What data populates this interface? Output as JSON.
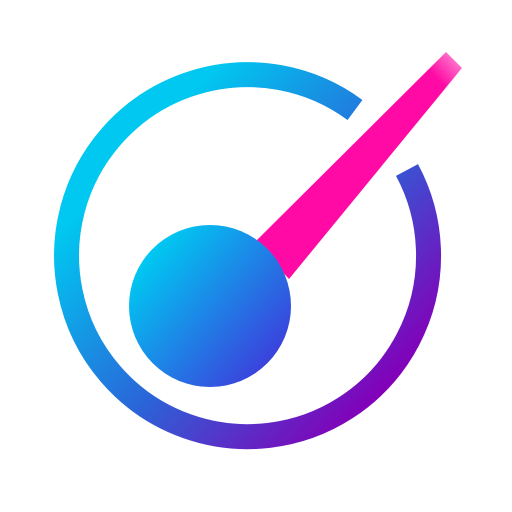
{
  "icon": {
    "name": "speedometer-gauge-icon",
    "colors": {
      "ring_start": "#00c8f0",
      "ring_mid": "#2b63d8",
      "ring_end": "#8300b8",
      "needle": "#ff0aa4",
      "needle_tip": "#ff9ad8",
      "hub_start": "#00c7f1",
      "hub_end": "#3c3fdc",
      "background": "#ffffff"
    }
  }
}
